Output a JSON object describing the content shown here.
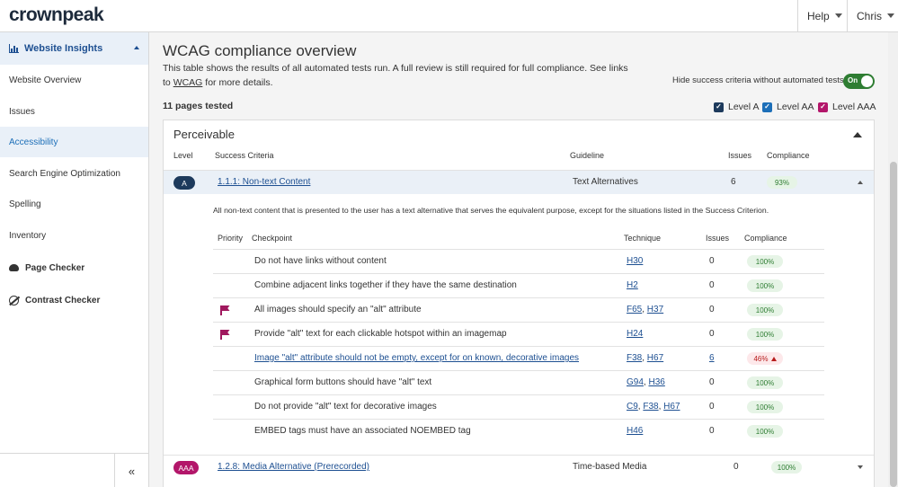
{
  "header": {
    "logo_prefix": "crownpeak",
    "help_label": "Help",
    "user_label": "Chris"
  },
  "sidebar": {
    "section_label": "Website Insights",
    "items": [
      {
        "label": "Website Overview"
      },
      {
        "label": "Issues"
      },
      {
        "label": "Accessibility"
      },
      {
        "label": "Search Engine Optimization"
      },
      {
        "label": "Spelling"
      },
      {
        "label": "Inventory"
      }
    ],
    "tools": [
      {
        "label": "Page Checker",
        "icon": "cloud-upload-icon"
      },
      {
        "label": "Contrast Checker",
        "icon": "contrast-icon"
      }
    ],
    "collapse_glyph": "«"
  },
  "main": {
    "title": "WCAG compliance overview",
    "intro_1": "This table shows the results of all automated tests run. A full review is still required for full compliance. See links to ",
    "intro_link": "WCAG",
    "intro_2": " for more details.",
    "hide_toggle_label": "Hide success criteria without automated tests",
    "toggle_state": "On",
    "pages_tested": "11 pages tested",
    "level_filters": [
      {
        "label": "Level A",
        "color": "#1d3a5c"
      },
      {
        "label": "Level AA",
        "color": "#1d6fb8"
      },
      {
        "label": "Level AAA",
        "color": "#b3166a"
      }
    ]
  },
  "panel": {
    "title": "Perceivable",
    "columns": {
      "level": "Level",
      "criteria": "Success Criteria",
      "guideline": "Guideline",
      "issues": "Issues",
      "compliance": "Compliance"
    },
    "criteria": [
      {
        "level": "A",
        "level_color": "#1d3a5c",
        "name": "1.1.1: Non-text Content",
        "guideline": "Text Alternatives",
        "issues": "6",
        "compliance": "93%",
        "description": "All non-text content that is presented to the user has a text alternative that serves the equivalent purpose, except for the situations listed in the Success Criterion.",
        "sub_columns": {
          "priority": "Priority",
          "checkpoint": "Checkpoint",
          "technique": "Technique",
          "issues": "Issues",
          "compliance": "Compliance"
        },
        "checkpoints": [
          {
            "text": "Do not have links without content",
            "techniques": [
              "H30"
            ],
            "issues": "0",
            "compliance": "100%"
          },
          {
            "text": "Combine adjacent links together if they have the same destination",
            "techniques": [
              "H2"
            ],
            "issues": "0",
            "compliance": "100%"
          },
          {
            "text": "All images should specify an \"alt\" attribute",
            "techniques": [
              "F65",
              "H37"
            ],
            "issues": "0",
            "compliance": "100%"
          },
          {
            "text": "Provide \"alt\" text for each clickable hotspot within an imagemap",
            "techniques": [
              "H24"
            ],
            "issues": "0",
            "compliance": "100%"
          },
          {
            "text": "Image \"alt\" attribute should not be empty, except for on known, decorative images",
            "techniques": [
              "F38",
              "H67"
            ],
            "issues": "6",
            "compliance": "46%"
          },
          {
            "text": "Graphical form buttons should have \"alt\" text",
            "techniques": [
              "G94",
              "H36"
            ],
            "issues": "0",
            "compliance": "100%"
          },
          {
            "text": "Do not provide \"alt\" text for decorative images",
            "techniques": [
              "C9",
              "F38",
              "H67"
            ],
            "issues": "0",
            "compliance": "100%"
          },
          {
            "text": "EMBED tags must have an associated NOEMBED tag",
            "techniques": [
              "H46"
            ],
            "issues": "0",
            "compliance": "100%"
          }
        ]
      },
      {
        "level": "AAA",
        "level_color": "#b3166a",
        "name": "1.2.8: Media Alternative (Prerecorded)",
        "guideline": "Time-based Media",
        "issues": "0",
        "compliance": "100%"
      }
    ]
  }
}
